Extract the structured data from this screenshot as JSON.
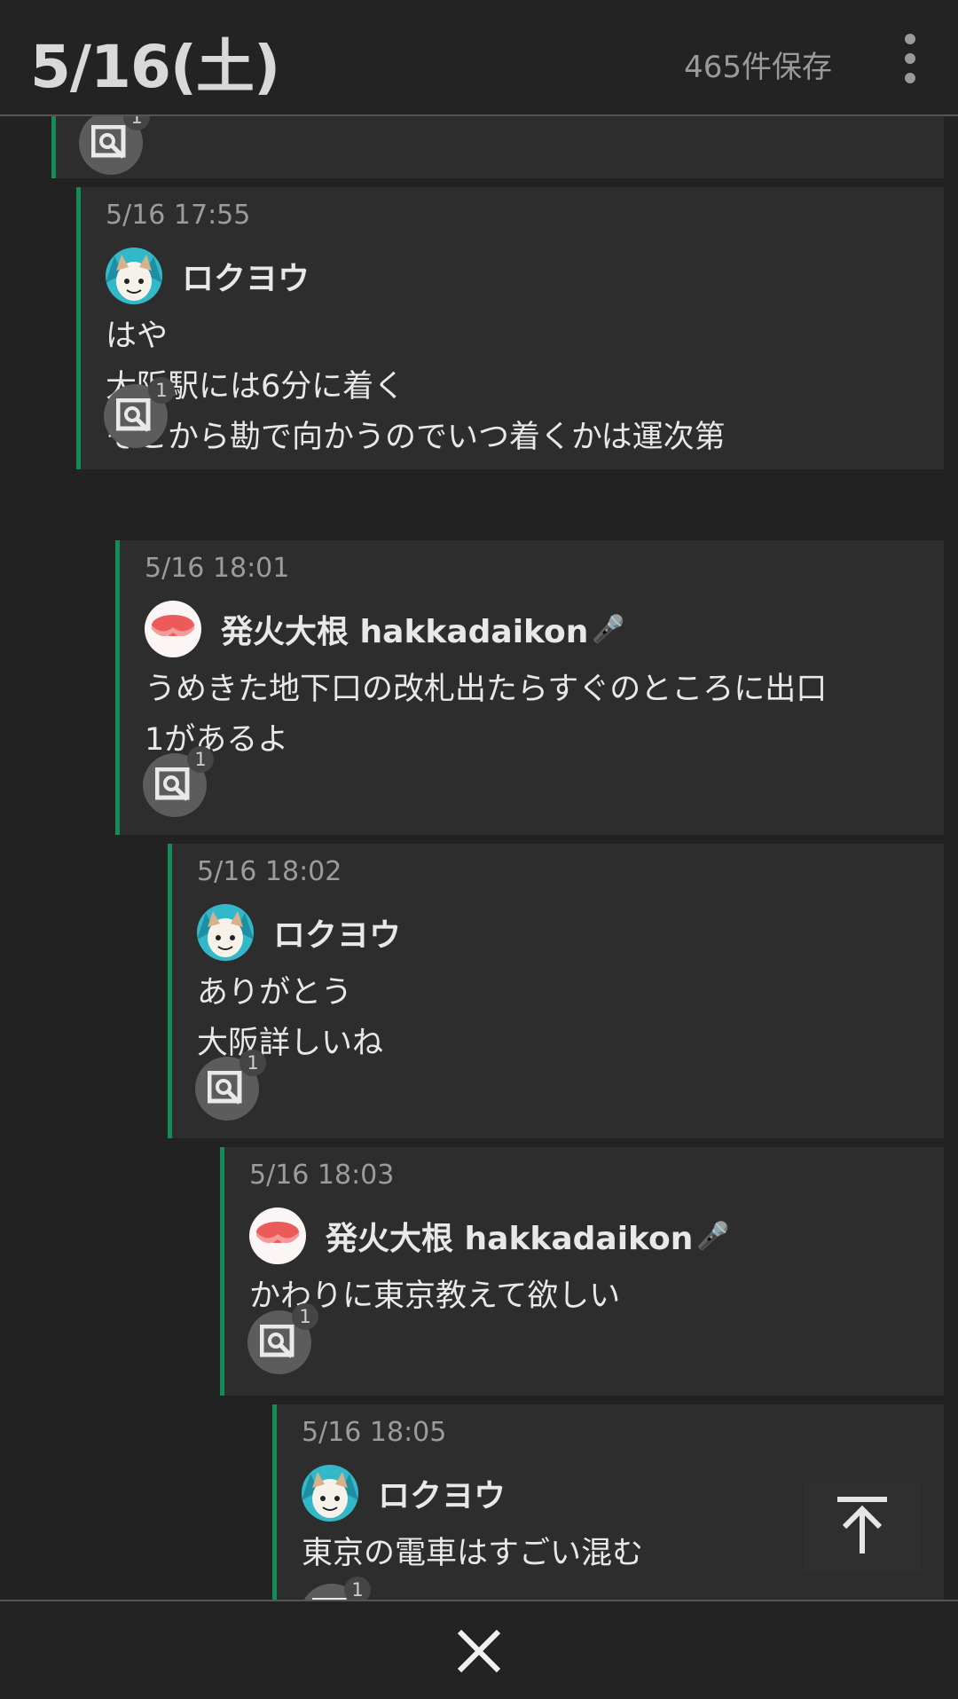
{
  "header": {
    "title": "5/16(土)",
    "saved_count": "465件保存"
  },
  "posts": [
    {
      "time": "",
      "author": "",
      "lines": [],
      "reply_count": "1"
    },
    {
      "time": "5/16 17:55",
      "author": "ロクヨウ",
      "mic": "",
      "lines": [
        "はや",
        "大阪駅には6分に着く",
        "そこから勘で向かうのでいつ着くかは運次第"
      ],
      "reply_count": "1"
    },
    {
      "time": "5/16 18:01",
      "author": "発火大根 hakkadaikon",
      "mic": "🎤",
      "lines": [
        "うめきた地下口の改札出たらすぐのところに出口",
        "1があるよ"
      ],
      "reply_count": "1"
    },
    {
      "time": "5/16 18:02",
      "author": "ロクヨウ",
      "mic": "",
      "lines": [
        "ありがとう",
        "大阪詳しいね"
      ],
      "reply_count": "1"
    },
    {
      "time": "5/16 18:03",
      "author": "発火大根 hakkadaikon",
      "mic": "🎤",
      "lines": [
        "かわりに東京教えて欲しい"
      ],
      "reply_count": "1"
    },
    {
      "time": "5/16 18:05",
      "author": "ロクヨウ",
      "mic": "",
      "lines": [
        "東京の電車はすごい混む"
      ],
      "reply_count": "1"
    }
  ],
  "icons": {
    "menu": "more-vert-icon",
    "search": "image-search-icon",
    "scroll_top": "arrow-upward-icon",
    "close": "close-icon"
  },
  "colors": {
    "accent": "#168a55",
    "background": "#222222",
    "card": "#2d2d2d"
  }
}
